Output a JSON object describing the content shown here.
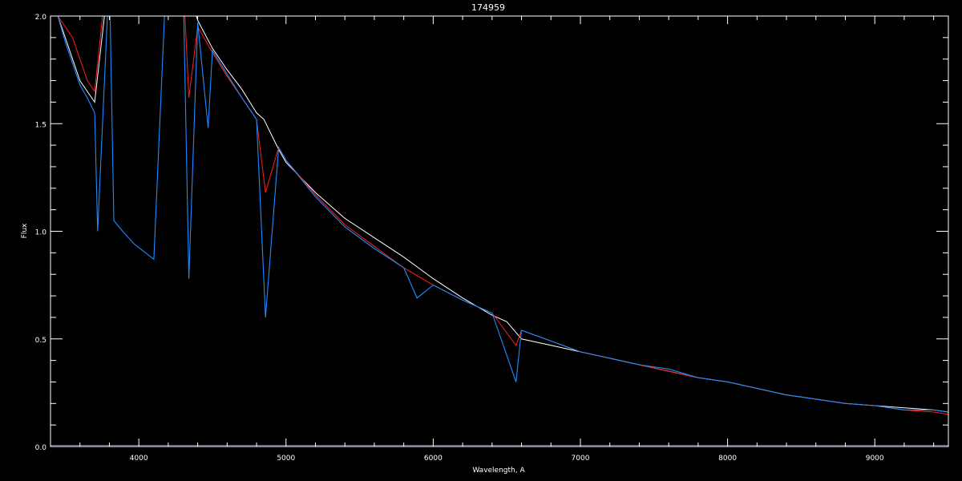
{
  "chart_data": {
    "type": "line",
    "title": "174959",
    "xlabel": "Wavelength, A",
    "ylabel": "Flux",
    "xlim": [
      3400,
      9500
    ],
    "ylim": [
      0.0,
      2.0
    ],
    "x_ticks": [
      4000,
      5000,
      6000,
      7000,
      8000,
      9000
    ],
    "x_tick_labels": [
      "4000",
      "5000",
      "6000",
      "7000",
      "8000",
      "9000"
    ],
    "y_ticks": [
      0.0,
      0.5,
      1.0,
      1.5,
      2.0
    ],
    "y_tick_labels": [
      "0.0",
      "0.5",
      "1.0",
      "1.5",
      "2.0"
    ],
    "background": "#000000",
    "grid": false,
    "series": [
      {
        "color": "#ffffff",
        "x": [
          3450,
          3500,
          3550,
          3600,
          3650,
          3700,
          3800,
          3900,
          4000,
          4100,
          4200,
          4300,
          4400,
          4500,
          4600,
          4700,
          4800,
          4850,
          4950,
          5000,
          5200,
          5400,
          5600,
          5800,
          6000,
          6200,
          6400,
          6500,
          6600,
          6800,
          7000,
          7200,
          7400,
          7600,
          7800,
          8000,
          8200,
          8400,
          8600,
          8800,
          9000,
          9200,
          9400,
          9500
        ],
        "y": [
          2.0,
          1.9,
          1.8,
          1.7,
          1.65,
          1.6,
          2.2,
          2.4,
          2.5,
          2.5,
          2.4,
          2.2,
          1.98,
          1.85,
          1.75,
          1.66,
          1.55,
          1.52,
          1.38,
          1.32,
          1.18,
          1.06,
          0.97,
          0.88,
          0.78,
          0.69,
          0.61,
          0.58,
          0.5,
          0.47,
          0.44,
          0.41,
          0.38,
          0.35,
          0.32,
          0.3,
          0.27,
          0.24,
          0.22,
          0.2,
          0.19,
          0.18,
          0.17,
          0.16
        ]
      },
      {
        "color": "#ff2020",
        "x": [
          3450,
          3500,
          3550,
          3600,
          3650,
          3700,
          3800,
          3900,
          4000,
          4100,
          4200,
          4300,
          4340,
          4400,
          4500,
          4600,
          4700,
          4800,
          4861,
          4950,
          5000,
          5200,
          5400,
          5600,
          5800,
          6000,
          6200,
          6400,
          6563,
          6600,
          6800,
          7000,
          7200,
          7400,
          7600,
          7800,
          8000,
          8200,
          8400,
          8600,
          8800,
          9000,
          9200,
          9400,
          9500
        ],
        "y": [
          2.0,
          1.95,
          1.9,
          1.8,
          1.7,
          1.65,
          2.3,
          2.5,
          2.5,
          2.5,
          2.4,
          2.2,
          1.62,
          1.95,
          1.83,
          1.72,
          1.62,
          1.52,
          1.18,
          1.39,
          1.33,
          1.17,
          1.03,
          0.93,
          0.83,
          0.75,
          0.68,
          0.62,
          0.47,
          0.54,
          0.49,
          0.44,
          0.41,
          0.38,
          0.35,
          0.32,
          0.3,
          0.27,
          0.24,
          0.22,
          0.2,
          0.19,
          0.17,
          0.16,
          0.15
        ]
      },
      {
        "color": "#1e8cff",
        "x": [
          3450,
          3500,
          3550,
          3600,
          3650,
          3700,
          3720,
          3800,
          3830,
          3890,
          3970,
          4102,
          4200,
          4300,
          4340,
          4400,
          4471,
          4500,
          4600,
          4700,
          4800,
          4861,
          4950,
          5000,
          5200,
          5400,
          5600,
          5800,
          5890,
          6000,
          6200,
          6400,
          6563,
          6600,
          6800,
          7000,
          7200,
          7400,
          7600,
          7800,
          8000,
          8200,
          8400,
          8600,
          8800,
          9000,
          9200,
          9400,
          9500
        ],
        "y": [
          2.0,
          1.88,
          1.78,
          1.68,
          1.62,
          1.55,
          1.0,
          2.2,
          1.05,
          1.0,
          0.94,
          0.87,
          2.4,
          2.2,
          0.78,
          1.97,
          1.48,
          1.84,
          1.73,
          1.62,
          1.52,
          0.6,
          1.39,
          1.33,
          1.16,
          1.02,
          0.92,
          0.83,
          0.69,
          0.75,
          0.68,
          0.62,
          0.3,
          0.54,
          0.49,
          0.44,
          0.41,
          0.38,
          0.36,
          0.32,
          0.3,
          0.27,
          0.24,
          0.22,
          0.2,
          0.19,
          0.17,
          0.17,
          0.16
        ]
      }
    ]
  }
}
